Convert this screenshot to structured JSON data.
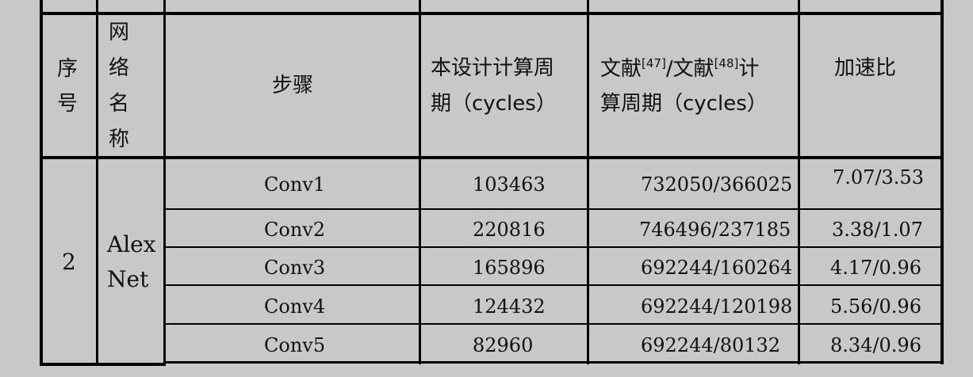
{
  "table": {
    "headers": {
      "index": [
        "序",
        "号"
      ],
      "network": [
        "网",
        "络",
        "名",
        "称"
      ],
      "step": "步骤",
      "this_design": [
        "本设计计算周",
        "期（cycles）"
      ],
      "ref_prefix": "文献",
      "ref1": "[47]",
      "ref_mid": "/文献",
      "ref2": "[48]",
      "ref_suffix": "计",
      "ref_line2": "算周期（cycles）",
      "speedup": "加速比"
    },
    "group": {
      "index": "2",
      "network_line1": "Alex",
      "network_line2": "Net"
    },
    "rows": [
      {
        "step": "Conv1",
        "this_design": "103463",
        "reference": "732050/366025",
        "speedup": "7.07/3.53"
      },
      {
        "step": "Conv2",
        "this_design": "220816",
        "reference": "746496/237185",
        "speedup": "3.38/1.07"
      },
      {
        "step": "Conv3",
        "this_design": "165896",
        "reference": "692244/160264",
        "speedup": "4.17/0.96"
      },
      {
        "step": "Conv4",
        "this_design": "124432",
        "reference": "692244/120198",
        "speedup": "5.56/0.96"
      },
      {
        "step": "Conv5",
        "this_design": "82960",
        "reference": "692244/80132",
        "speedup": "8.34/0.96"
      }
    ]
  }
}
